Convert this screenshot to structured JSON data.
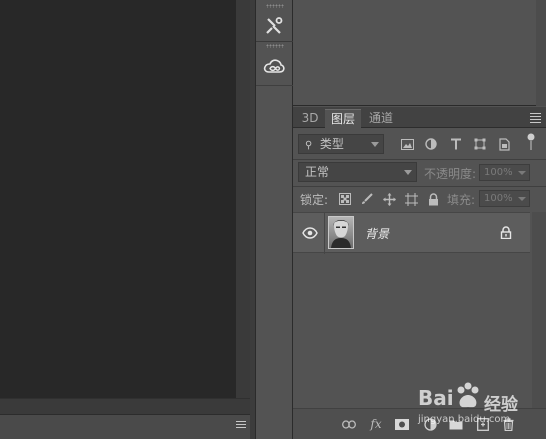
{
  "tabs": [
    {
      "label": "3D"
    },
    {
      "label": "图层"
    },
    {
      "label": "通道"
    }
  ],
  "filter": {
    "kind_label": "类型"
  },
  "blend": {
    "mode": "正常",
    "opacity_label": "不透明度:",
    "opacity_value": "100%"
  },
  "lock": {
    "label": "锁定:",
    "fill_label": "填充:",
    "fill_value": "100%"
  },
  "layers": [
    {
      "name": "背景",
      "visible": true,
      "locked": true
    }
  ],
  "footer_icons": [
    "link-icon",
    "fx-icon",
    "mask-icon",
    "adjustment-icon",
    "folder-icon",
    "new-layer-icon",
    "trash-icon"
  ],
  "footer": {
    "fx_label": "fx"
  },
  "watermark": {
    "brand_left": "Bai",
    "brand_right": "经验",
    "url": "jingyan.baidu.com"
  },
  "dock_icons": [
    "tools-icon",
    "creative-cloud-icon"
  ],
  "colors": {
    "canvas": "#282828",
    "panel": "#535353",
    "tabbar": "#424242",
    "selected_layer": "#5d5d5d"
  }
}
